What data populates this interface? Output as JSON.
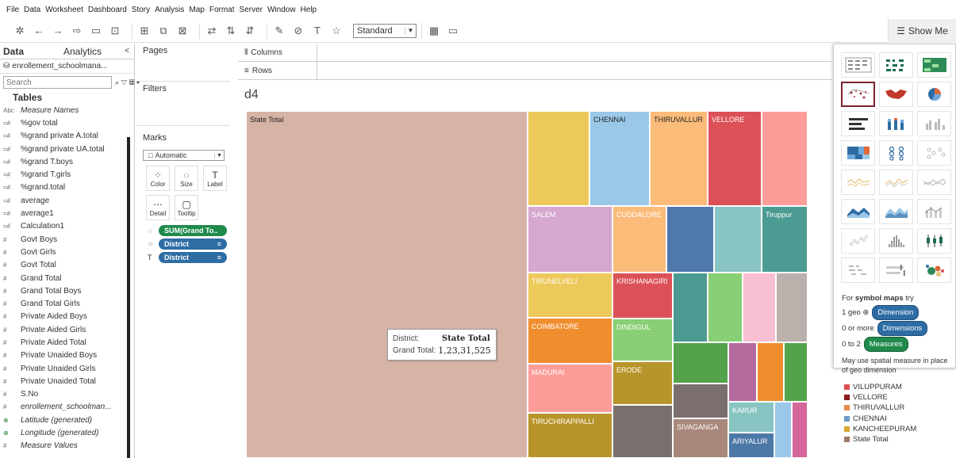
{
  "menu": [
    "File",
    "Data",
    "Worksheet",
    "Dashboard",
    "Story",
    "Analysis",
    "Map",
    "Format",
    "Server",
    "Window",
    "Help"
  ],
  "toolbar": {
    "standard_label": "Standard",
    "show_me_label": "Show Me",
    "icons": [
      "tableau-logo-icon",
      "undo-icon",
      "redo-icon",
      "forward-icon",
      "save-icon",
      "add-datasource-icon",
      "new-worksheet-icon",
      "duplicate-icon",
      "clear-icon",
      "swap-icon",
      "sort-ascending-icon",
      "sort-descending-icon",
      "highlight-icon",
      "group-icon",
      "labels-icon",
      "pin-icon",
      "fit-icon",
      "presentation-icon"
    ]
  },
  "left_pane": {
    "tab_data": "Data",
    "tab_analytics": "Analytics",
    "collapse_arrow": "<",
    "datasource": "enrollement_schoolmana...",
    "search_placeholder": "Search",
    "tables_heading": "Tables",
    "fields": [
      {
        "icon": "Abc",
        "name": "Measure Names",
        "italic": true
      },
      {
        "icon": "=#",
        "name": "%gov total"
      },
      {
        "icon": "=#",
        "name": "%grand private A.total"
      },
      {
        "icon": "=#",
        "name": "%grand private UA.total"
      },
      {
        "icon": "=#",
        "name": "%grand T.boys"
      },
      {
        "icon": "=#",
        "name": "%grand T.girls"
      },
      {
        "icon": "=#",
        "name": "%grand.total"
      },
      {
        "icon": "=#",
        "name": "average"
      },
      {
        "icon": "=#",
        "name": "average1"
      },
      {
        "icon": "=#",
        "name": "Calculation1"
      },
      {
        "icon": "#",
        "name": "Govt Boys"
      },
      {
        "icon": "#",
        "name": "Govt Girls"
      },
      {
        "icon": "#",
        "name": "Govt Total"
      },
      {
        "icon": "#",
        "name": "Grand Total"
      },
      {
        "icon": "#",
        "name": "Grand Total Boys"
      },
      {
        "icon": "#",
        "name": "Grand Total Girls"
      },
      {
        "icon": "#",
        "name": "Private Aided Boys"
      },
      {
        "icon": "#",
        "name": "Private Aided Girls"
      },
      {
        "icon": "#",
        "name": "Private Aided Total"
      },
      {
        "icon": "#",
        "name": "Private Unaided Boys"
      },
      {
        "icon": "#",
        "name": "Private Unaided Girls"
      },
      {
        "icon": "#",
        "name": "Private Unaided Total"
      },
      {
        "icon": "#",
        "name": "S.No"
      },
      {
        "icon": "#",
        "name": "enrollement_schoolman...",
        "italic": true
      },
      {
        "icon": "⊕",
        "name": "Latitude (generated)",
        "italic": true,
        "geo": true
      },
      {
        "icon": "⊕",
        "name": "Longitude (generated)",
        "italic": true,
        "geo": true
      },
      {
        "icon": "#",
        "name": "Measure Values",
        "italic": true
      }
    ]
  },
  "cards": {
    "pages": "Pages",
    "filters": "Filters",
    "marks": "Marks",
    "mark_type": "Automatic",
    "buttons": [
      {
        "icon": "⁘",
        "label": "Color"
      },
      {
        "icon": "◌",
        "label": "Size"
      },
      {
        "icon": "T",
        "label": "Label"
      },
      {
        "icon": "⋯",
        "label": "Detail"
      },
      {
        "icon": "▢",
        "label": "Tooltip"
      }
    ],
    "pills": [
      {
        "icon": "◌",
        "label": "SUM(Grand To..",
        "color": "green"
      },
      {
        "icon": "⁘",
        "label": "District",
        "color": "blue"
      },
      {
        "icon": "T",
        "label": "District",
        "color": "blue"
      }
    ]
  },
  "shelves": {
    "columns": "Columns",
    "rows": "Rows"
  },
  "sheet": {
    "title": "d4"
  },
  "treemap": {
    "tiles": [
      {
        "label": "State Total",
        "color": "#d6b3a7",
        "dark": true
      },
      {
        "label": "",
        "color": "#ecc95a"
      },
      {
        "label": "CHENNAI",
        "color": "#9bc8e8",
        "dark": true
      },
      {
        "label": "THIRUVALLUR",
        "color": "#fbbb79",
        "dark": true
      },
      {
        "label": "VELLORE",
        "color": "#dc5158"
      },
      {
        "label": "",
        "color": "#fd9d9a"
      },
      {
        "label": "SALEM",
        "color": "#d6a7cf"
      },
      {
        "label": "CUDDALORE",
        "color": "#fbbb79"
      },
      {
        "label": "",
        "color": "#4f78ac"
      },
      {
        "label": "",
        "color": "#88c5c2"
      },
      {
        "label": "Tiruppur",
        "color": "#4c9b93"
      },
      {
        "label": "TIRUNELVELI",
        "color": "#ecc95a"
      },
      {
        "label": "KRISHANAGIRI",
        "color": "#dc5158"
      },
      {
        "label": "",
        "color": "#4c9b93"
      },
      {
        "label": "",
        "color": "#89cf75"
      },
      {
        "label": "",
        "color": "#f9bfd2"
      },
      {
        "label": "",
        "color": "#bab0ac"
      },
      {
        "label": "COIMBATORE",
        "color": "#f08e2e"
      },
      {
        "label": "DINDIGUL",
        "color": "#89cf75"
      },
      {
        "label": "MADURAI",
        "color": "#fd9d9a"
      },
      {
        "label": "ERODE",
        "color": "#b8952a"
      },
      {
        "label": "",
        "color": "#54a24b"
      },
      {
        "label": "",
        "color": "#b56a9d"
      },
      {
        "label": "",
        "color": "#f08e2e"
      },
      {
        "label": "",
        "color": "#54a24b"
      },
      {
        "label": "TIRUCHIRAPPALLI",
        "color": "#b8952a"
      },
      {
        "label": "",
        "color": "#79706e"
      },
      {
        "label": "",
        "color": "#7a6f6e"
      },
      {
        "label": "SIVAGANGA",
        "color": "#a8887a"
      },
      {
        "label": "KARUR",
        "color": "#88c5c2"
      },
      {
        "label": "ARIYALUR",
        "color": "#4c78a8"
      },
      {
        "label": "",
        "color": "#9bc8e8"
      },
      {
        "label": "",
        "color": "#d6679a"
      }
    ],
    "tooltip": {
      "district_key": "District:",
      "district_value": "State Total",
      "total_key": "Grand Total:",
      "total_value": "1,23,31,525"
    }
  },
  "show_me": {
    "hint_prefix": "For",
    "hint_bold": "symbol maps",
    "hint_suffix": "try",
    "line1_prefix": "1 geo ⊕",
    "line1_pill": "Dimension",
    "line2_prefix": "0 or more",
    "line2_pill": "Dimensions",
    "line3_prefix": "0 to 2",
    "line3_pill": "Measures",
    "note": "May use spatial measure in place of geo dimension"
  },
  "legend": [
    {
      "label": "VILUPPURAM",
      "color": "#dc5158"
    },
    {
      "label": "VELLORE",
      "color": "#8b1a1a"
    },
    {
      "label": "THIRUVALLUR",
      "color": "#e08a4c"
    },
    {
      "label": "CHENNAI",
      "color": "#6f9bc4"
    },
    {
      "label": "KANCHEEPURAM",
      "color": "#d9a72f"
    },
    {
      "label": "State Total",
      "color": "#9b7a6a"
    }
  ]
}
